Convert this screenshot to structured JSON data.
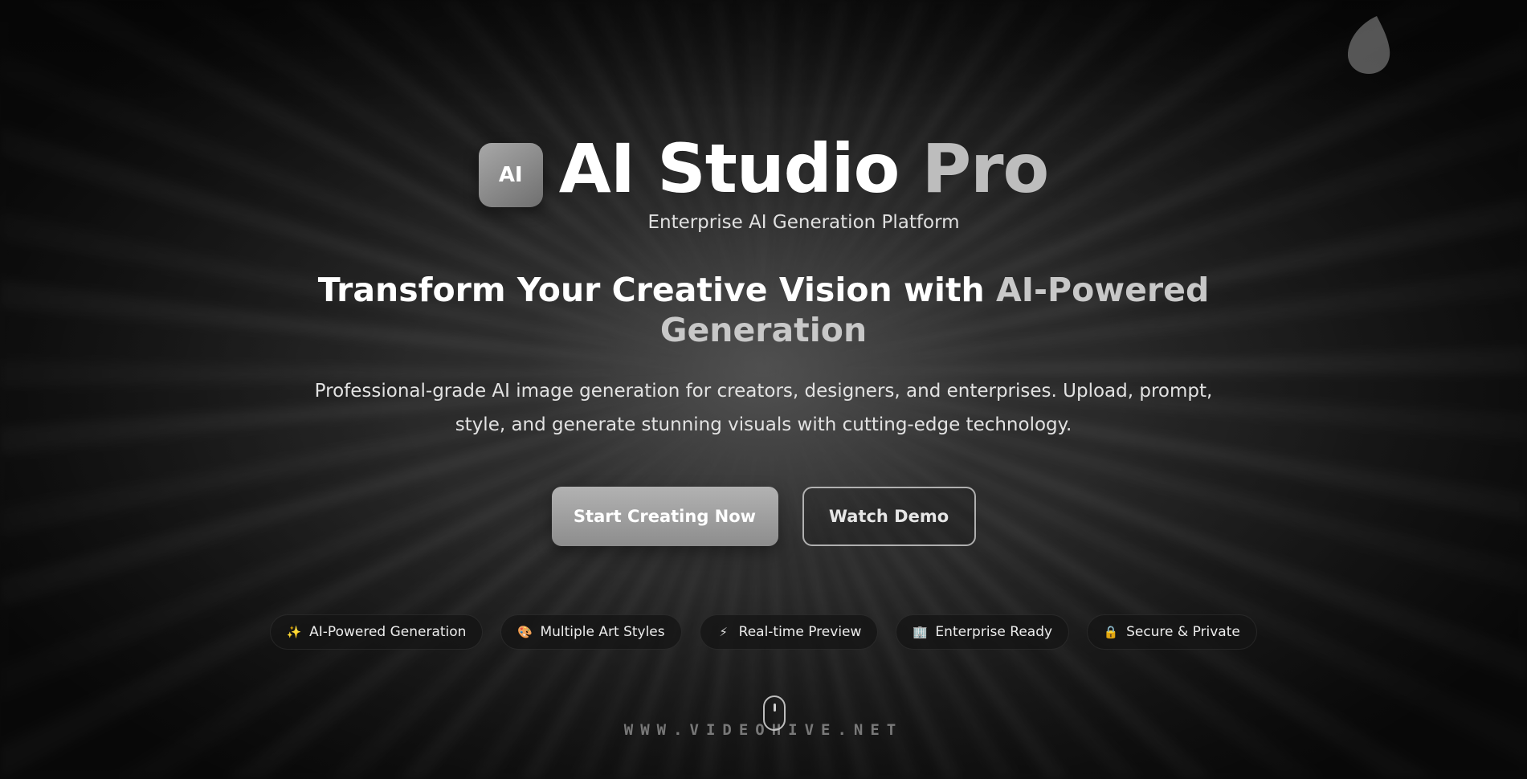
{
  "brand": {
    "badge_text": "AI",
    "title_main": "AI Studio ",
    "title_accent": "Pro",
    "subtitle": "Enterprise AI Generation Platform"
  },
  "hero": {
    "headline_main": "Transform Your Creative Vision with ",
    "headline_accent": "AI-Powered Generation",
    "description": "Professional-grade AI image generation for creators, designers, and enterprises. Upload, prompt, style, and generate stunning visuals with cutting-edge technology."
  },
  "cta": {
    "primary_label": "Start Creating Now",
    "secondary_label": "Watch Demo"
  },
  "features": [
    {
      "icon": "sparkles-icon",
      "glyph": "✨",
      "label": "AI-Powered Generation"
    },
    {
      "icon": "palette-icon",
      "glyph": "🎨",
      "label": "Multiple Art Styles"
    },
    {
      "icon": "lightning-icon",
      "glyph": "⚡",
      "label": "Real-time Preview"
    },
    {
      "icon": "building-icon",
      "glyph": "🏢",
      "label": "Enterprise Ready"
    },
    {
      "icon": "lock-icon",
      "glyph": "🔒",
      "label": "Secure & Private"
    }
  ],
  "watermark": "WWW.VIDEOHIVE.NET",
  "colors": {
    "background": "#2a2a2a",
    "accent_text": "#bdbdbd",
    "primary_button": "#9e9e9e"
  }
}
